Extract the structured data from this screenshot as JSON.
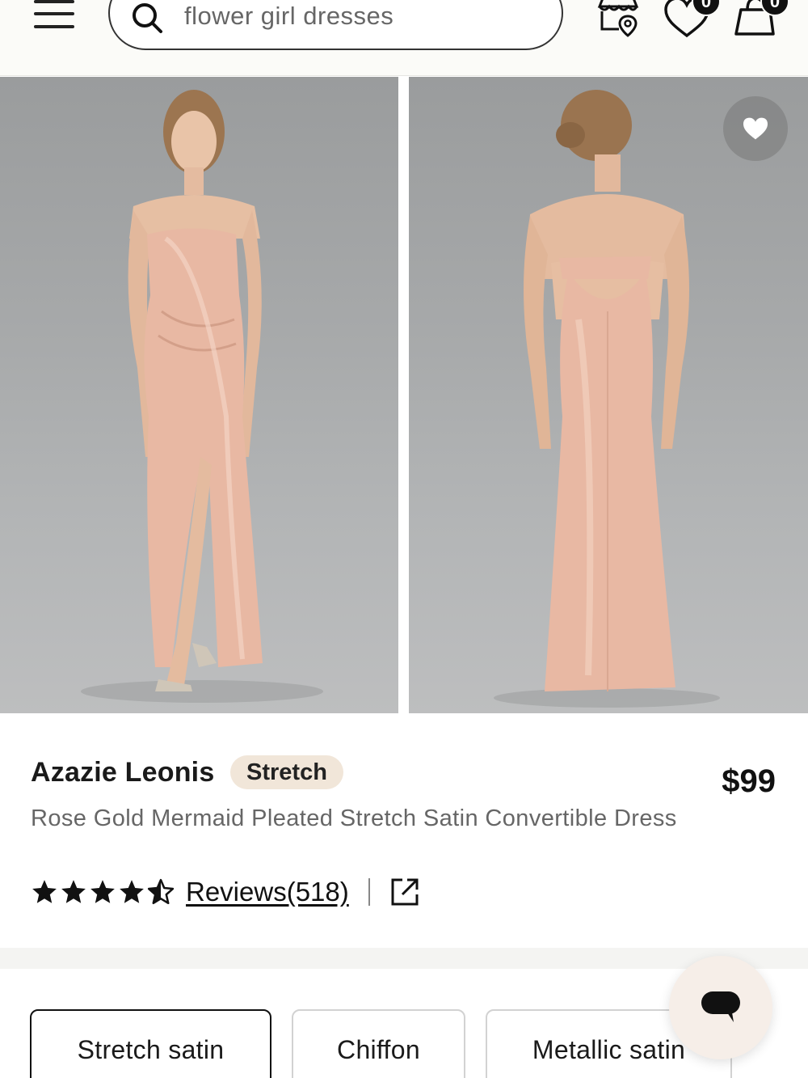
{
  "header": {
    "menu_label": "Menu",
    "search": {
      "placeholder": "flower girl dresses",
      "value": ""
    },
    "icons": [
      "menu-icon",
      "search-icon",
      "store-locator-icon",
      "heart-icon",
      "shopping-bag-icon"
    ],
    "wishlist_count": "0",
    "bag_count": "0"
  },
  "gallery": {
    "images": [
      {
        "name": "front-view-photo",
        "alt": "Model wearing dress, front view"
      },
      {
        "name": "back-view-photo",
        "alt": "Model wearing dress, back view"
      }
    ],
    "favorite_icon": "heart-icon"
  },
  "product": {
    "brand": "Azazie Leonis",
    "tag": "Stretch",
    "price": "$99",
    "description": "Rose Gold Mermaid Pleated Stretch Satin Convertible Dress",
    "rating": 4.5,
    "reviews_label": "Reviews(518)",
    "share_icon": "share-external-icon"
  },
  "fabrics": [
    {
      "label": "Stretch satin",
      "selected": true
    },
    {
      "label": "Chiffon",
      "selected": false
    },
    {
      "label": "Metallic satin",
      "selected": false
    }
  ],
  "chat": {
    "icon": "chat-bubble-icon"
  },
  "colors": {
    "header_bg": "#fbfbf8",
    "tag_bg": "#f1e6d9",
    "dress": "#e8b8a3",
    "backdrop": "#a7a9aa",
    "chat_bg": "#f6eee8"
  }
}
